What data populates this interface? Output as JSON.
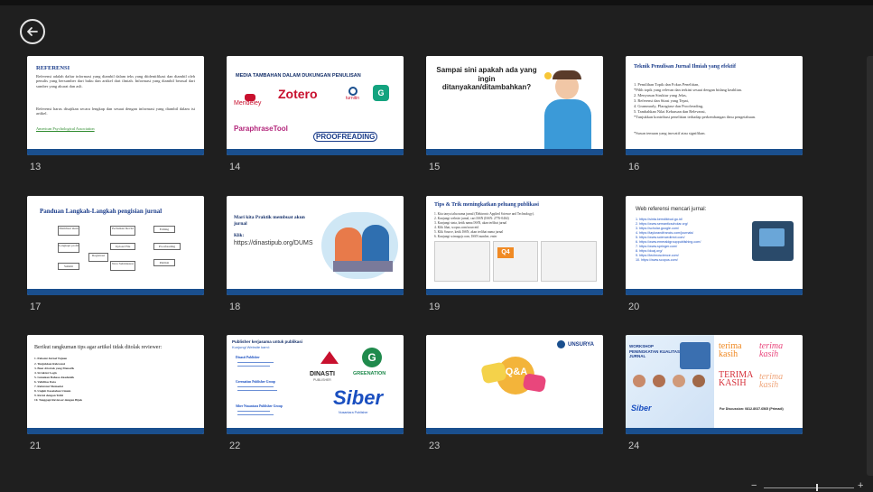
{
  "nav": {
    "back_icon": "arrow-left-icon"
  },
  "slides": [
    {
      "number": "13",
      "title": "REFERENSI",
      "text": "Referensi adalah daftar informasi yang diambil dalam teks yang diidentifikasi dan diambil oleh penulis yang bersumber dari buku dan artikel dari ilmiah. Informasi yang diambil berasal dari sumber yang akurat dan asli.",
      "text2": "Referensi harus disajikan secara lengkap dan sesuai dengan informasi yang diambil dalam isi artikel.",
      "link": "American Psychological Association"
    },
    {
      "number": "14",
      "title": "MEDIA TAMBAHAN DALAM DUKUNGAN PENULISAN",
      "logos": [
        "Mendeley",
        "Zotero",
        "turnitin",
        "Grammarly",
        "ParaphraseTool",
        "PROOFREADING"
      ]
    },
    {
      "number": "15",
      "title": "Sampai sini apakah ada yang ingin ditanyakan/ditambahkan?"
    },
    {
      "number": "16",
      "title": "Teknik Penulisan Jurnal Ilmiah yang efektif",
      "items": [
        "1. Pemilihan Topik dan Fokus Penelitian,",
        "*Pilih topik yang relevan dan terkini sesuai dengan bidang keahlian.",
        "2. Menyusun Struktur yang Jelas,",
        "3. Referensi dan Sitasi yang Tepat,",
        "4. Grammarly, Plaragiase dan Proofreading,",
        "5. Tambahkan Nilai Kebaruan dan Relevansi,",
        "*Tunjukkan kontribusi penelitian terhadap perkembangan ilmu pengetahuan.",
        "*Susun temuan yang inovatif atau signifikan."
      ]
    },
    {
      "number": "17",
      "title": "Panduan Langkah-Langkah pengisian jurnal",
      "flow": [
        "Membuat akun",
        "Perbaikan Revisi",
        "Editing",
        "Lengkapi profil",
        "Upload File",
        "Proofreading",
        "Registrasi",
        "Submit",
        "Publish",
        "Nota Submission"
      ]
    },
    {
      "number": "18",
      "title": "Mari kita Praktik membuat akun jurnal",
      "link_label": "Klik:",
      "link": "https://dinastipub.org/DUMS"
    },
    {
      "number": "19",
      "title": "Tips & Trik meningkatkan peluang publikasi",
      "items": [
        "1. Kita tanya tahu nama jurnal (Elektronic Applied Science and Technology).",
        "2. Kunjungi website jurnal, cari ISSN (ISSN: 2776-0464)",
        "3. Kunjungi sinta, ketik nama ISSN, akan terlihat jurnal",
        "4. Klik lihat, scopus.com/sourceid",
        "5. Klik Source, ketik ISSN, akan terlihat nama jurnal",
        "6. Kunjungi scimagojr.com, ISSN number, enter"
      ],
      "badge": "Q4"
    },
    {
      "number": "20",
      "title": "Web referensi mencari jurnal:",
      "links": [
        "1. https://sinta.kemdikbud.go.id/",
        "2. https://www.semanticscholar.org/",
        "3. https://scholar.google.com/",
        "4. https://taylorandfrancis.com/journals/",
        "5. https://www.sciencedirect.com/",
        "6. https://www.emeraldgrouppublishing.com/",
        "7. https://www.springer.com/",
        "8. https://doaj.org/",
        "9. https://technoscience.com/",
        "10. https://www.scopus.com/"
      ]
    },
    {
      "number": "21",
      "title": "Berikut rangkuman tips agar artikel tidak ditolak reviewer:",
      "items": [
        "1. Pahami Jurnal Tujuan",
        "2. Tunjukkan Relevansi",
        "3. Buat Abstrak yang Menarik",
        "4. Struktur Logis",
        "5. Gunakan Bahasa Akademik",
        "6. Validitas Data",
        "7. Referensi Memadai",
        "8. Ungkit Kesalahan Umum",
        "9. Revisi dengan Teliti",
        "10. Tanggapi Reviewer dengan Bijak"
      ]
    },
    {
      "number": "22",
      "title": "Publisher kerjasama untuk publikasi",
      "subtitle": "Kunjungi Website kami:",
      "publishers": [
        "Dinasti Publisher",
        "Greenation Publisher Group",
        "Siber Nusantara Publisher Group"
      ],
      "logo_texts": [
        "DINASTI",
        "PUBLISHER",
        "GREENATION",
        "Siber",
        "Nusantara Publisher"
      ]
    },
    {
      "number": "23",
      "badge_text": "Q&A",
      "logo_text": "UNSURYA"
    },
    {
      "number": "24",
      "title": "WORKSHOP PENINGKATAN KUALITAS JURNAL",
      "thanks": [
        "terima kasih",
        "terima kasih",
        "TERIMA KASIH",
        "terima kasih"
      ],
      "contact": "For Discussion: 0812.8037.6565 (Primadi)",
      "footer_logo": "Siber"
    }
  ],
  "zoom": {
    "minus": "−",
    "plus": "+"
  }
}
